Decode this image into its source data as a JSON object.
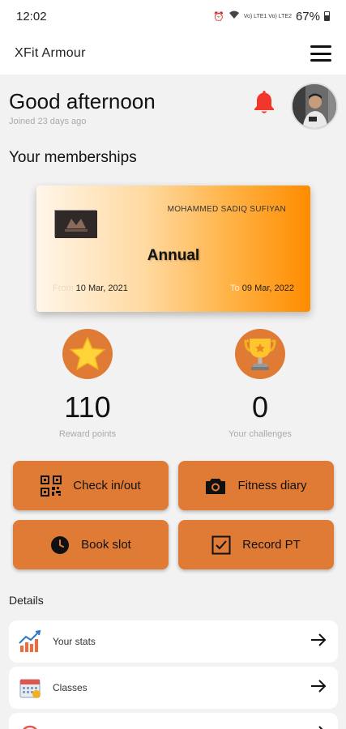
{
  "status_bar": {
    "time": "12:02",
    "signal_text": "Vo) LTE1 Vo) LTE2",
    "battery": "67%"
  },
  "app_bar": {
    "title": "XFit Armour",
    "menu_icon": "hamburger-menu-icon"
  },
  "header": {
    "greeting": "Good afternoon",
    "joined": "Joined 23 days ago",
    "bell_icon": "bell-icon",
    "bell_color": "#f2362b"
  },
  "memberships": {
    "title": "Your memberships",
    "card": {
      "member_name": "MOHAMMED SADIQ SUFIYAN",
      "plan": "Annual",
      "from_label": "From",
      "from_date": "10 Mar, 2021",
      "to_label": "To",
      "to_date": "09 Mar, 2022"
    }
  },
  "stats": [
    {
      "icon": "star-icon",
      "value": "110",
      "label": "Reward points"
    },
    {
      "icon": "trophy-icon",
      "value": "0",
      "label": "Your challenges"
    }
  ],
  "actions": [
    {
      "icon": "qr-code-icon",
      "label": "Check in/out"
    },
    {
      "icon": "camera-icon",
      "label": "Fitness diary"
    },
    {
      "icon": "clock-icon",
      "label": "Book slot"
    },
    {
      "icon": "checkbox-icon",
      "label": "Record PT"
    }
  ],
  "details": {
    "title": "Details",
    "items": [
      {
        "icon": "stats-chart-icon",
        "label": "Your stats"
      },
      {
        "icon": "calendar-icon",
        "label": "Classes"
      }
    ]
  },
  "colors": {
    "accent": "#e07b35",
    "card_gradient_end": "#ff8c00",
    "background": "#f2f2f2"
  }
}
